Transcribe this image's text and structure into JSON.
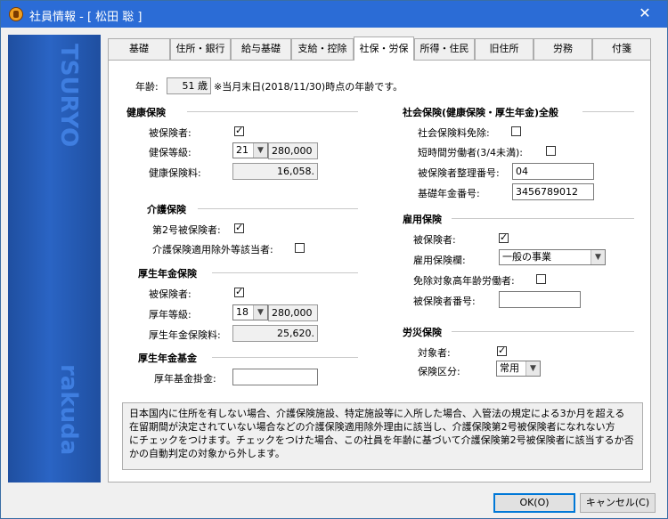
{
  "window": {
    "title": "社員情報 - [ 松田 聡 ]",
    "close_label": "✕"
  },
  "tabs": [
    "基礎",
    "住所・銀行",
    "給与基礎",
    "支給・控除",
    "社保・労保",
    "所得・住民",
    "旧住所",
    "労務",
    "付箋"
  ],
  "active_tab": "社保・労保",
  "age": {
    "label": "年齢:",
    "value": "51 歳",
    "note": "※当月末日(2018/11/30)時点の年齢です。"
  },
  "health": {
    "title": "健康保険",
    "insured_label": "被保険者:",
    "insured": true,
    "grade_label": "健保等級:",
    "grade": "21",
    "grade_amount": "280,000",
    "premium_label": "健康保険料:",
    "premium": "16,058."
  },
  "care": {
    "title": "介護保険",
    "type2_label": "第2号被保険者:",
    "type2": true,
    "exempt_label": "介護保険適用除外等該当者:",
    "exempt": false
  },
  "pension": {
    "title": "厚生年金保険",
    "insured_label": "被保険者:",
    "insured": true,
    "grade_label": "厚年等級:",
    "grade": "18",
    "grade_amount": "280,000",
    "premium_label": "厚生年金保険料:",
    "premium": "25,620."
  },
  "fund": {
    "title": "厚生年金基金",
    "contribution_label": "厚年基金掛金:",
    "contribution": ""
  },
  "social": {
    "title": "社会保険(健康保険・厚生年金)全般",
    "exempt_label": "社会保険料免除:",
    "exempt": false,
    "short_time_label": "短時間労働者(3/4未満):",
    "short_time": false,
    "ref_no_label": "被保険者整理番号:",
    "ref_no": "04",
    "pension_no_label": "基礎年金番号:",
    "pension_no": "3456789012"
  },
  "employment": {
    "title": "雇用保険",
    "insured_label": "被保険者:",
    "insured": true,
    "category_label": "雇用保険欄:",
    "category": "一般の事業",
    "elderly_exempt_label": "免除対象高年齢労働者:",
    "elderly_exempt": false,
    "insured_no_label": "被保険者番号:",
    "insured_no": ""
  },
  "accident": {
    "title": "労災保険",
    "target_label": "対象者:",
    "target": true,
    "category_label": "保険区分:",
    "category": "常用"
  },
  "note_lines": [
    "日本国内に住所を有しない場合、介護保険施設、特定施設等に入所した場合、入管法の規定による3か月を超える",
    "在留期間が決定されていない場合などの介護保険適用除外理由に該当し、介護保険第2号被保険者になれない方",
    "にチェックをつけます。チェックをつけた場合、この社員を年齢に基づいて介護保険第2号被保険者に該当するか否",
    "かの自動判定の対象から外します。"
  ],
  "buttons": {
    "ok": "OK(O)",
    "cancel": "キャンセル(C)"
  },
  "sidebar": {
    "watermark_top": "TSURYO",
    "watermark_bottom": "rakuda"
  },
  "colors": {
    "titlebar": "#2b6cd6",
    "sidebar": "#2a64c4",
    "focus": "#0078d7"
  }
}
